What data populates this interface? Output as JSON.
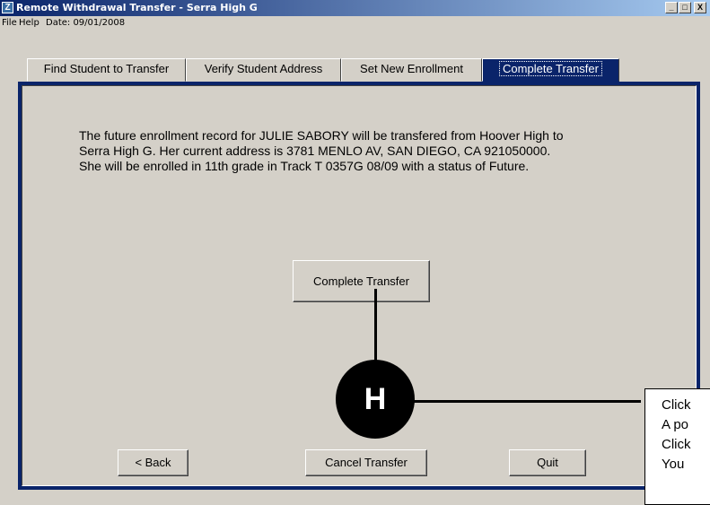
{
  "window": {
    "title": "Remote Withdrawal Transfer - Serra High G",
    "icon_letter": "Z",
    "controls": {
      "minimize": "_",
      "maximize": "□",
      "close": "X"
    }
  },
  "menu": {
    "file": "File",
    "help": "Help",
    "date": "Date: 09/01/2008"
  },
  "tabs": [
    {
      "label": "Find Student to Transfer"
    },
    {
      "label": "Verify Student Address"
    },
    {
      "label": "Set New Enrollment"
    },
    {
      "label": "Complete Transfer",
      "active": true
    }
  ],
  "message": {
    "line1": "The future enrollment record for JULIE SABORY will be transfered from Hoover High to",
    "line2": "Serra High G. Her current address is 3781 MENLO AV, SAN DIEGO, CA 921050000.",
    "line3": "She will be enrolled in 11th grade in Track T 0357G 08/09 with a status of Future."
  },
  "buttons": {
    "complete": "Complete Transfer",
    "back": "< Back",
    "cancel": "Cancel Transfer",
    "quit": "Quit"
  },
  "annotation": {
    "marker": "H",
    "callout_lines": [
      "Click",
      "A po",
      "Click",
      "You"
    ]
  },
  "colors": {
    "titlebar_start": "#0a246a",
    "titlebar_end": "#a6caf0",
    "active_tab": "#0a246a",
    "panel_bg": "#d4d0c8"
  }
}
